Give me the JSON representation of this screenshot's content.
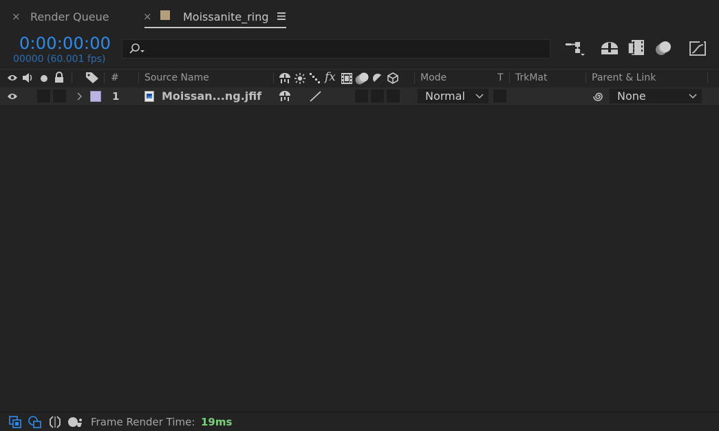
{
  "tabs": [
    {
      "label": "Render Queue",
      "close": "×",
      "active": false
    },
    {
      "label": "Moissanite_ring",
      "close": "×",
      "active": true,
      "swatch_color": "#b49f7c"
    }
  ],
  "timecode": {
    "time": "0:00:00:00",
    "frames": "00000 (60.001 fps)",
    "color": "#2d8ceb"
  },
  "search": {
    "placeholder": ""
  },
  "columns": {
    "number": "#",
    "source_name": "Source Name",
    "fx": "fx",
    "mode": "Mode",
    "t": "T",
    "trkmat": "TrkMat",
    "parent": "Parent & Link"
  },
  "layers": [
    {
      "number": "1",
      "name": "Moissan...ng.jfif",
      "mode": "Normal",
      "parent": "None",
      "label_color": "#b9b4e1"
    }
  ],
  "status": {
    "label": "Frame Render Time:",
    "value": "19ms",
    "value_color": "#7bd17b"
  },
  "icons": [
    "close-icon",
    "menu-icon",
    "search-icon",
    "comp-flowchart-icon",
    "draft-3d-icon",
    "frame-blending-icon",
    "motion-blur-icon",
    "graph-editor-icon",
    "eye-icon",
    "audio-icon",
    "solo-icon",
    "lock-icon",
    "label-icon",
    "shy-icon",
    "collapse-icon",
    "quality-icon",
    "effect-icon",
    "adjustment-icon",
    "3d-layer-icon",
    "expand-chevron-icon",
    "image-file-icon",
    "pickwhip-icon",
    "dropdown-chevron-icon"
  ]
}
